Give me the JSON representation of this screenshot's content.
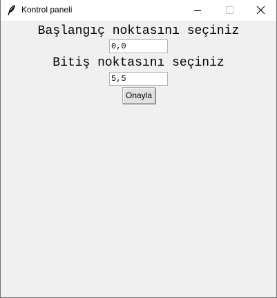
{
  "window": {
    "title": "Kontrol paneli",
    "icon": "feather-icon"
  },
  "controls": {
    "minimize_icon": "minimize-icon",
    "maximize_icon": "maximize-icon",
    "close_icon": "close-icon"
  },
  "form": {
    "start_label": "Başlangıç noktasını seçiniz",
    "start_value": "0,0",
    "end_label": "Bitiş noktasını seçiniz",
    "end_value": "5,5",
    "confirm_label": "Onayla"
  }
}
